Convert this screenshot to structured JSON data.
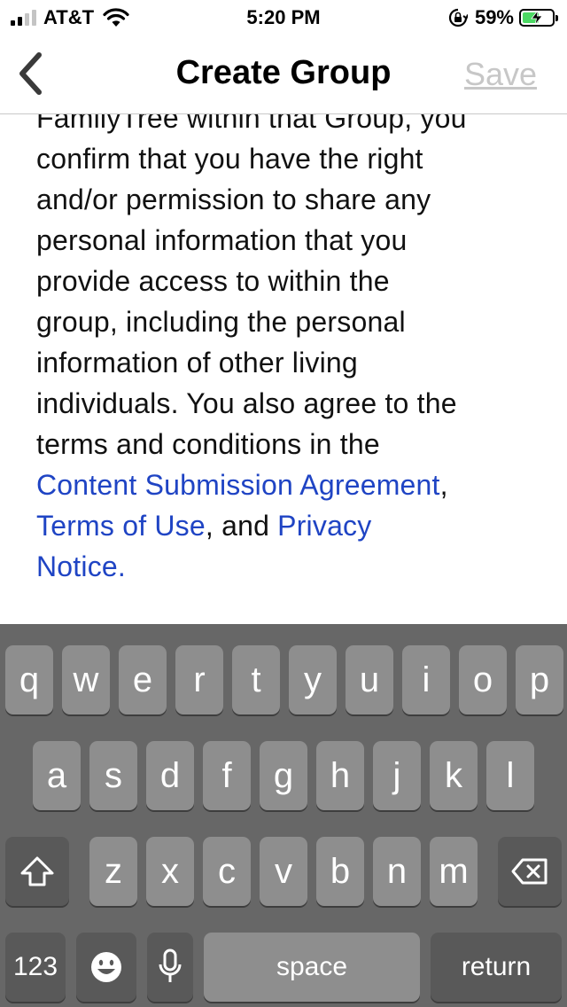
{
  "status_bar": {
    "carrier": "AT&T",
    "time": "5:20 PM",
    "battery_percent": "59%",
    "signal_bars": 2,
    "icons": [
      "signal-icon",
      "wifi-icon",
      "orientation-lock-icon",
      "battery-charging-icon"
    ]
  },
  "nav": {
    "back_icon": "chevron-left-icon",
    "title": "Create Group",
    "save_label": "Save"
  },
  "terms": {
    "line1": "FamilyTree within that Group, you",
    "line2": "confirm that you have the right",
    "line3": "and/or permission to share any",
    "line4": "personal information that you",
    "line5": "provide access to within the",
    "line6": "group, including the personal",
    "line7": "information of other living",
    "line8": "individuals.  You also agree to the",
    "line9": "terms and conditions in the",
    "link_csa": "Content Submission Agreement",
    "comma1": ",",
    "link_tou": "Terms of Use",
    "and_text": ", and ",
    "link_privacy_1": "Privacy",
    "link_privacy_2": "Notice."
  },
  "keyboard": {
    "row1": [
      "q",
      "w",
      "e",
      "r",
      "t",
      "y",
      "u",
      "i",
      "o",
      "p"
    ],
    "row2": [
      "a",
      "s",
      "d",
      "f",
      "g",
      "h",
      "j",
      "k",
      "l"
    ],
    "row3": [
      "z",
      "x",
      "c",
      "v",
      "b",
      "n",
      "m"
    ],
    "numbers_label": "123",
    "space_label": "space",
    "return_label": "return",
    "colors": {
      "keyboard_bg": "#676767",
      "letter_key": "#8e8e8e",
      "function_key": "#595959",
      "link": "#1f44c4"
    }
  }
}
